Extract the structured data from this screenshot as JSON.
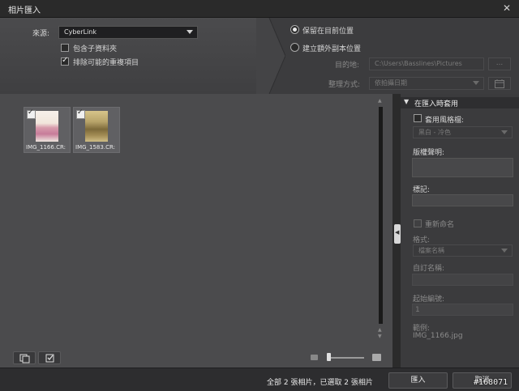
{
  "window": {
    "title": "相片匯入"
  },
  "source": {
    "label": "來源:",
    "value": "CyberLink"
  },
  "options": {
    "include_subfolders": {
      "label": "包含子資料夾",
      "checked": false
    },
    "exclude_duplicates": {
      "label": "排除可能的重複項目",
      "checked": true
    }
  },
  "destination": {
    "keep_location": {
      "label": "保留在目前位置",
      "selected": true
    },
    "create_copy": {
      "label": "建立額外副本位置",
      "selected": false
    },
    "target_label": "目的地:",
    "target_path": "C:\\Users\\Basslines\\Pictures",
    "browse_label": "...",
    "organize_label": "整理方式:",
    "organize_value": "依拍攝日期"
  },
  "thumbnails": [
    {
      "filename": "IMG_1166.CR:",
      "checked": true,
      "photo_colors": [
        "#f4eee8",
        "#c77c9a",
        "#e9c4b3"
      ]
    },
    {
      "filename": "IMG_1583.CR:",
      "checked": true,
      "photo_colors": [
        "#b8a46a",
        "#7d6a3a",
        "#d6c48a"
      ]
    }
  ],
  "right_panel": {
    "header": "在匯入時套用",
    "apply_preset": {
      "label": "套用風格檔:",
      "checked": false
    },
    "preset_value": "黑白 - 冷色",
    "copyright_label": "版權聲明:",
    "tags_label": "標記:",
    "rename": {
      "label": "重新命名",
      "checked": false
    },
    "format_label": "格式:",
    "format_value": "檔案名稱",
    "custom_name_label": "自訂名稱:",
    "start_number_label": "起始編號:",
    "start_number_value": "1",
    "example_label": "範例:",
    "example_value": "IMG_1166.jpg"
  },
  "status": {
    "summary": "全部 2 張相片，已選取 2 張相片"
  },
  "buttons": {
    "import": "匯入",
    "cancel": "取消"
  },
  "watermark": "#168071"
}
